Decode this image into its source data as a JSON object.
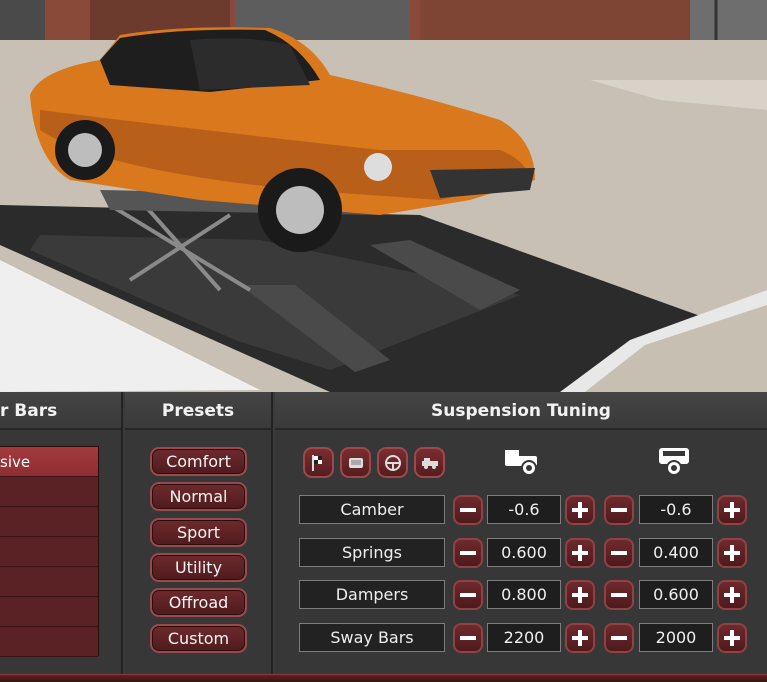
{
  "panels": {
    "bars_title": "r Bars",
    "presets_title": "Presets",
    "tuning_title": "Suspension Tuning"
  },
  "bars_list": {
    "items": [
      {
        "label": "sive",
        "selected": true
      },
      {
        "label": "",
        "selected": false
      },
      {
        "label": "",
        "selected": false
      },
      {
        "label": "",
        "selected": false
      },
      {
        "label": "",
        "selected": false
      },
      {
        "label": "",
        "selected": false
      },
      {
        "label": "",
        "selected": false
      }
    ]
  },
  "presets": [
    {
      "label": "Comfort"
    },
    {
      "label": "Normal"
    },
    {
      "label": "Sport"
    },
    {
      "label": "Utility"
    },
    {
      "label": "Offroad"
    },
    {
      "label": "Custom"
    }
  ],
  "mode_icons": [
    "race-flag-icon",
    "seat-icon",
    "steering-wheel-icon",
    "tow-truck-icon"
  ],
  "axles": [
    "front-axle-car-icon",
    "rear-axle-car-icon"
  ],
  "tuning": [
    {
      "label": "Camber",
      "front": "-0.6",
      "rear": "-0.6"
    },
    {
      "label": "Springs",
      "front": "0.600",
      "rear": "0.400"
    },
    {
      "label": "Dampers",
      "front": "0.800",
      "rear": "0.600"
    },
    {
      "label": "Sway Bars",
      "front": "2200",
      "rear": "2000"
    }
  ],
  "colors": {
    "accent": "#8e2e32",
    "button_border": "#9a4a4c",
    "car": "#d9781c"
  }
}
